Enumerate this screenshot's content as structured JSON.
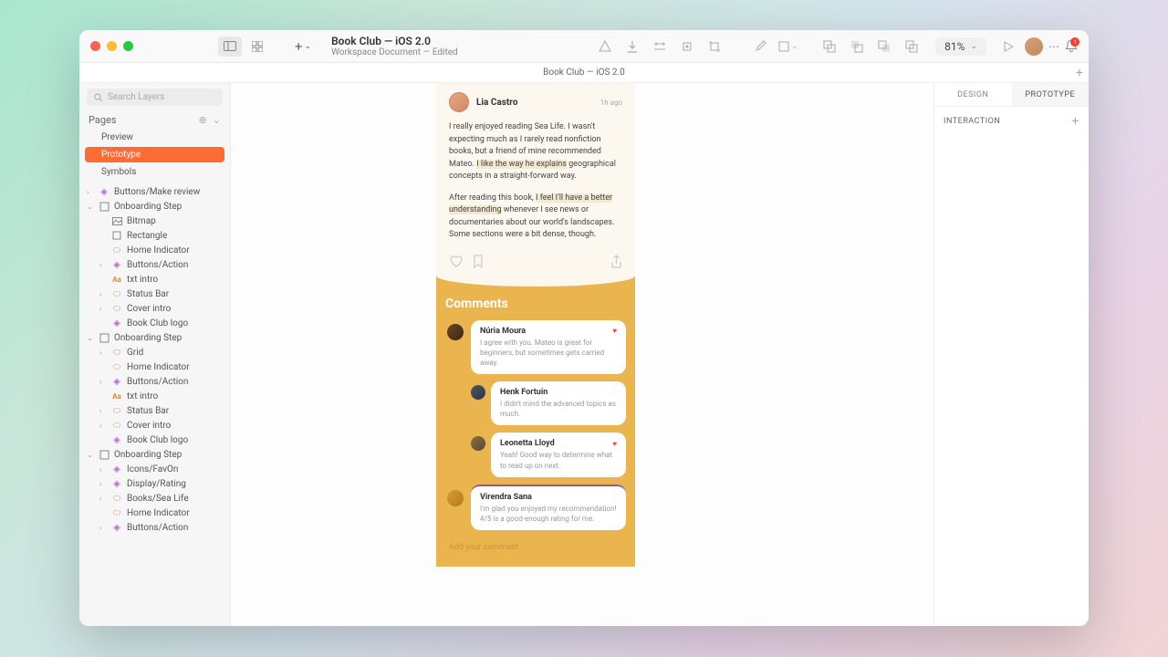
{
  "doc": {
    "title": "Book Club — iOS 2.0",
    "subtitle": "Workspace Document — Edited"
  },
  "tab": "Book Club — iOS 2.0",
  "zoom": "81%",
  "notification_count": "1",
  "search_placeholder": "Search Layers",
  "pages_label": "Pages",
  "pages": {
    "preview": "Preview",
    "prototype": "Prototype",
    "symbols": "Symbols"
  },
  "layers": {
    "make_review": "Buttons/Make review",
    "onboarding1": "Onboarding Step",
    "bitmap": "Bitmap",
    "rectangle": "Rectangle",
    "home_ind": "Home Indicator",
    "btn_action": "Buttons/Action",
    "txt_intro": "txt intro",
    "status_bar": "Status Bar",
    "cover_intro": "Cover intro",
    "logo": "Book Club logo",
    "onboarding2": "Onboarding Step",
    "grid": "Grid",
    "onboarding3": "Onboarding Step",
    "favon": "Icons/FavOn",
    "rating": "Display/Rating",
    "books_sea": "Books/Sea Life"
  },
  "right_panel": {
    "tab_design": "DESIGN",
    "tab_prototype": "PROTOTYPE",
    "interaction": "INTERACTION"
  },
  "mockup": {
    "reviewer": {
      "name": "Lia Castro",
      "time": "1h ago"
    },
    "para1a": "I really enjoyed reading Sea Life. I wasn't expecting much as I rarely read nonfiction books, but a friend of mine recommended Mateo. ",
    "para1_hl": "I like the way he explains",
    "para1b": " geographical concepts in a straight-forward way.",
    "para2a": "After reading this book, ",
    "para2_hl": "I feel I'll have a better understanding",
    "para2b": " whenever I see news or documentaries about our world's landscapes. Some sections were a bit dense, though.",
    "comments_title": "Comments",
    "c1": {
      "name": "Núria Moura",
      "text": "I agree with you. Mateo is great for beginners, but sometimes gets carried away."
    },
    "c2": {
      "name": "Henk Fortuin",
      "text": "I didn't mind the advanced topics as much."
    },
    "c3": {
      "name": "Leonetta Lloyd",
      "text": "Yeah! Good way to determine what to read up on next."
    },
    "c4": {
      "name": "Virendra Sana",
      "text": "I'm glad you enjoyed my recommendation! 4/5 is a good-enough rating for me."
    },
    "add_comment": "Add your comment"
  }
}
